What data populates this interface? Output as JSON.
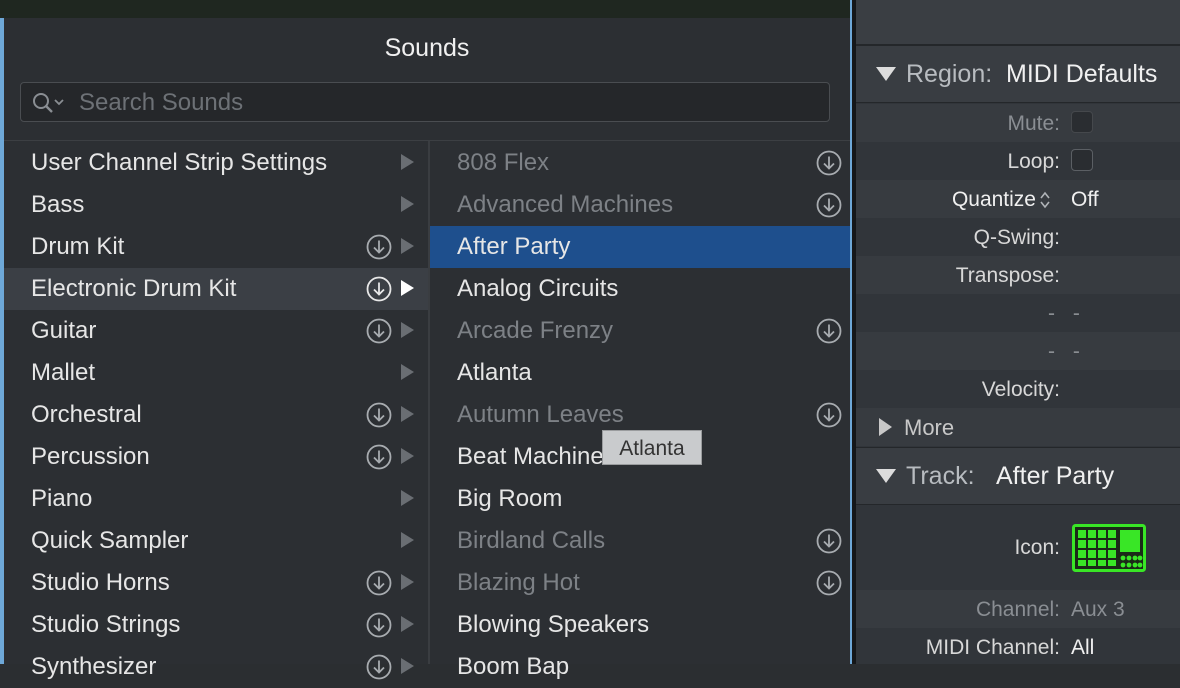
{
  "library": {
    "title": "Sounds",
    "search": {
      "placeholder": "Search Sounds",
      "value": ""
    },
    "categories": [
      {
        "label": "User Channel Strip Settings",
        "download": false,
        "selected": false
      },
      {
        "label": "Bass",
        "download": false,
        "selected": false
      },
      {
        "label": "Drum Kit",
        "download": true,
        "selected": false
      },
      {
        "label": "Electronic Drum Kit",
        "download": true,
        "selected": true
      },
      {
        "label": "Guitar",
        "download": true,
        "selected": false
      },
      {
        "label": "Mallet",
        "download": false,
        "selected": false
      },
      {
        "label": "Orchestral",
        "download": true,
        "selected": false
      },
      {
        "label": "Percussion",
        "download": true,
        "selected": false
      },
      {
        "label": "Piano",
        "download": false,
        "selected": false
      },
      {
        "label": "Quick Sampler",
        "download": false,
        "selected": false
      },
      {
        "label": "Studio Horns",
        "download": true,
        "selected": false
      },
      {
        "label": "Studio Strings",
        "download": true,
        "selected": false
      },
      {
        "label": "Synthesizer",
        "download": true,
        "selected": false
      }
    ],
    "sounds": [
      {
        "label": "808 Flex",
        "installed": false,
        "selected": false
      },
      {
        "label": "Advanced Machines",
        "installed": false,
        "selected": false
      },
      {
        "label": "After Party",
        "installed": true,
        "selected": true
      },
      {
        "label": "Analog Circuits",
        "installed": true,
        "selected": false
      },
      {
        "label": "Arcade Frenzy",
        "installed": false,
        "selected": false
      },
      {
        "label": "Atlanta",
        "installed": true,
        "selected": false
      },
      {
        "label": "Autumn Leaves",
        "installed": false,
        "selected": false
      },
      {
        "label": "Beat Machine",
        "installed": true,
        "selected": false
      },
      {
        "label": "Big Room",
        "installed": true,
        "selected": false
      },
      {
        "label": "Birdland Calls",
        "installed": false,
        "selected": false
      },
      {
        "label": "Blazing Hot",
        "installed": false,
        "selected": false
      },
      {
        "label": "Blowing Speakers",
        "installed": true,
        "selected": false
      },
      {
        "label": "Boom Bap",
        "installed": true,
        "selected": false
      }
    ],
    "tooltip": "Atlanta"
  },
  "inspector": {
    "region": {
      "header_label": "Region:",
      "header_value": "MIDI Defaults",
      "mute_label": "Mute:",
      "loop_label": "Loop:",
      "quantize_label": "Quantize",
      "quantize_value": "Off",
      "qswing_label": "Q-Swing:",
      "transpose_label": "Transpose:",
      "dash1": "- -",
      "dash2": "- -",
      "velocity_label": "Velocity:",
      "more_label": "More"
    },
    "track": {
      "header_label": "Track:",
      "header_value": "After Party",
      "icon_label": "Icon:",
      "icon_name": "drum-machine-icon",
      "channel_label": "Channel:",
      "channel_value": "Aux 3",
      "midi_channel_label": "MIDI Channel:",
      "midi_channel_value": "All"
    }
  },
  "colors": {
    "selection": "#1e4f8d",
    "accent_border": "#6ea8d8",
    "track_icon": "#39e626"
  }
}
